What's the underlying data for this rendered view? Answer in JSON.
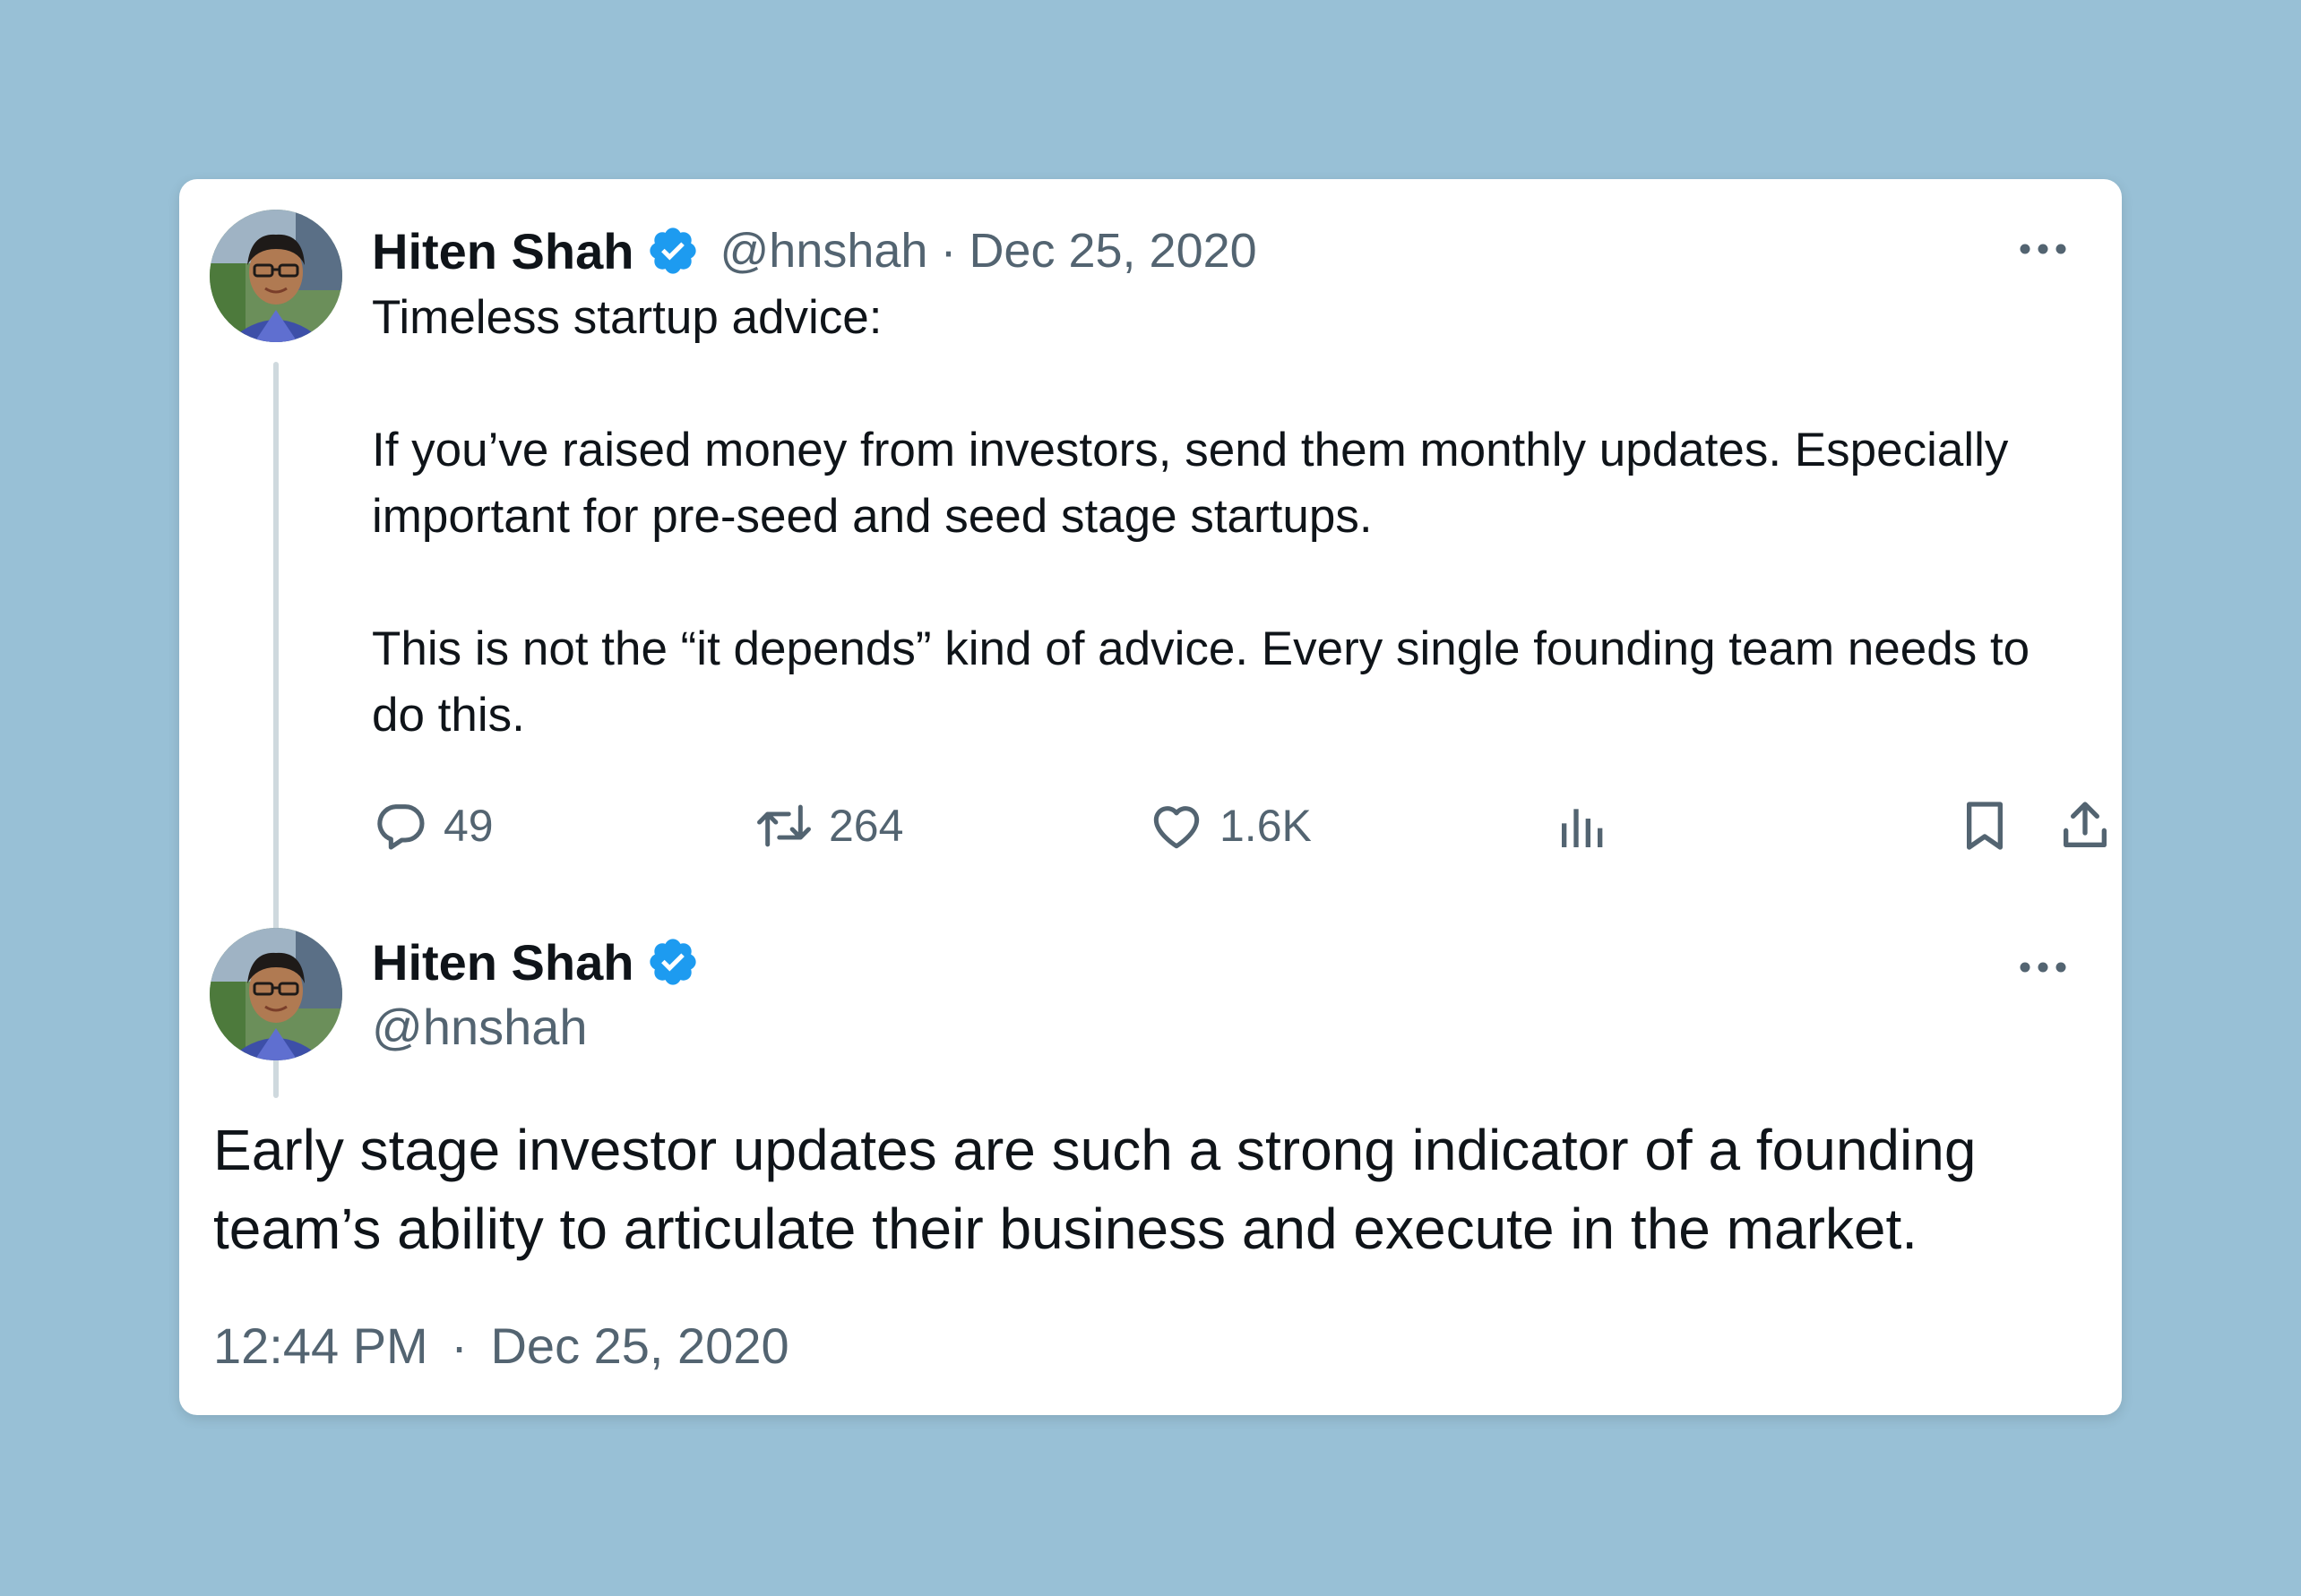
{
  "quoted_tweet": {
    "author_name": "Hiten Shah",
    "handle": "@hnshah",
    "separator": "·",
    "date": "Dec 25, 2020",
    "paragraphs": [
      "Timeless startup advice:",
      "If you’ve raised money from investors, send them monthly updates. Especially important for pre-seed and seed stage startups.",
      "This is not the “it depends” kind of advice. Every single founding team needs to do this."
    ],
    "actions": {
      "replies": "49",
      "retweets": "264",
      "likes": "1.6K"
    }
  },
  "main_tweet": {
    "author_name": "Hiten Shah",
    "handle": "@hnshah",
    "text": "Early stage investor updates are such a strong indicator of a founding team’s ability to articulate their business and execute in the market.",
    "time": "12:44 PM",
    "separator": "·",
    "date": "Dec 25, 2020"
  },
  "icons": {
    "verified": "verified-badge-icon",
    "more": "more-options-icon",
    "reply": "reply-icon",
    "retweet": "retweet-icon",
    "like": "heart-icon",
    "views": "analytics-icon",
    "bookmark": "bookmark-icon",
    "share": "share-icon"
  },
  "colors": {
    "background": "#98c0d6",
    "card": "#ffffff",
    "verified_blue": "#1d9bf0",
    "text_primary": "#0f1419",
    "text_secondary": "#536471",
    "thread_line": "#cfd9de"
  }
}
